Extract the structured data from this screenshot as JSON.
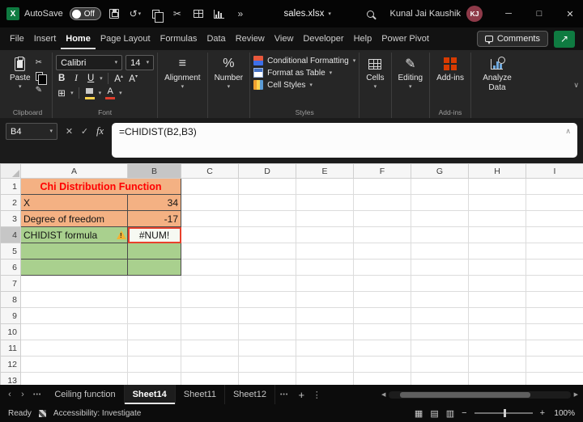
{
  "titlebar": {
    "autosave_label": "AutoSave",
    "autosave_state": "Off",
    "filename": "sales.xlsx",
    "user_name": "Kunal Jai Kaushik",
    "user_initials": "KJ"
  },
  "menubar": {
    "tabs": [
      "File",
      "Insert",
      "Home",
      "Page Layout",
      "Formulas",
      "Data",
      "Review",
      "View",
      "Developer",
      "Help",
      "Power Pivot"
    ],
    "active_tab": "Home",
    "comments_label": "Comments"
  },
  "ribbon": {
    "paste": "Paste",
    "clipboard_group": "Clipboard",
    "font_name": "Calibri",
    "font_size": "14",
    "bold": "B",
    "italic": "I",
    "underline": "U",
    "font_group": "Font",
    "alignment": "Alignment",
    "number": "Number",
    "conditional_formatting": "Conditional Formatting",
    "format_as_table": "Format as Table",
    "cell_styles": "Cell Styles",
    "styles_group": "Styles",
    "cells": "Cells",
    "editing": "Editing",
    "addins": "Add-ins",
    "addins_group": "Add-ins",
    "analyze_data": "Analyze Data"
  },
  "formula_bar": {
    "name_box": "B4",
    "fx_label": "fx",
    "formula": "=CHIDIST(B2,B3)"
  },
  "grid": {
    "columns": [
      "A",
      "B",
      "C",
      "D",
      "E",
      "F",
      "G",
      "H",
      "I"
    ],
    "row_count": 13,
    "selected_cell": "B4",
    "selected_column": "B",
    "selected_row": 4,
    "cells": [
      {
        "ref": "A1",
        "text": "Chi Distribution Function",
        "cls": "title",
        "colspan": 2
      },
      {
        "ref": "A2",
        "text": "X",
        "cls": "orange"
      },
      {
        "ref": "B2",
        "text": "34",
        "cls": "orange num"
      },
      {
        "ref": "A3",
        "text": "Degree of freedom",
        "cls": "orange"
      },
      {
        "ref": "B3",
        "text": "-17",
        "cls": "orange num"
      },
      {
        "ref": "A4",
        "text": "CHIDIST formula",
        "cls": "green warn"
      },
      {
        "ref": "B4",
        "text": "#NUM!",
        "cls": "green error selected"
      },
      {
        "ref": "A5",
        "text": "",
        "cls": "green"
      },
      {
        "ref": "B5",
        "text": "",
        "cls": "green"
      },
      {
        "ref": "A6",
        "text": "",
        "cls": "green"
      },
      {
        "ref": "B6",
        "text": "",
        "cls": "green"
      }
    ]
  },
  "sheetbar": {
    "tabs": [
      "Ceiling function",
      "Sheet14",
      "Sheet11",
      "Sheet12"
    ],
    "active_tab": "Sheet14"
  },
  "statusbar": {
    "ready": "Ready",
    "accessibility": "Accessibility: Investigate",
    "zoom": "100%"
  },
  "colors": {
    "excel_green": "#0f7b41",
    "orange_fill": "#F4B183",
    "green_fill": "#A9D08E",
    "title_text_red": "#FF0000",
    "selection_border": "#E8412C",
    "addins_icon_orange": "#D83B01"
  },
  "icons": {
    "dropdown": "▾",
    "undo": "↺",
    "cut": "✂",
    "overflow": "»",
    "minimize": "─",
    "maximize": "□",
    "close": "✕",
    "cancel": "✕",
    "enter": "✓",
    "borders": "⊞",
    "percent": "%",
    "alignment_lines": "≡",
    "pencil": "✎",
    "share": "↗",
    "collapse_up": "∧",
    "chevron_down": "∨",
    "prev_sheet": "‹",
    "next_sheet": "›",
    "tab_list": "•••",
    "add_sheet": "+",
    "kebab": "⋮",
    "scroll_left": "◀",
    "scroll_right": "▶",
    "view_normal": "▦",
    "view_layout": "▤",
    "view_break": "▥",
    "zoom_out": "−",
    "zoom_in": "+",
    "up_small": "▴",
    "down_small": "▾"
  }
}
